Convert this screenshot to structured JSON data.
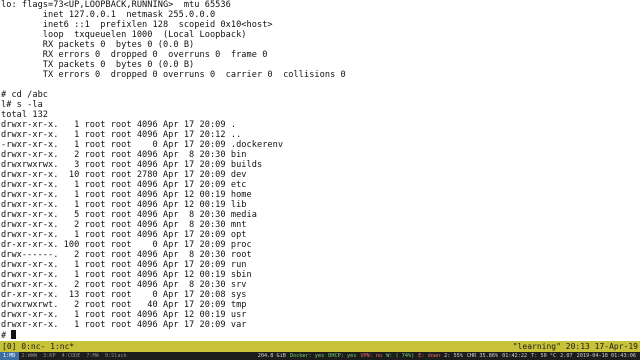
{
  "terminal": {
    "lines": [
      "lo: flags=73<UP,LOOPBACK,RUNNING>  mtu 65536",
      "        inet 127.0.0.1  netmask 255.0.0.0",
      "        inet6 ::1  prefixlen 128  scopeid 0x10<host>",
      "        loop  txqueuelen 1000  (Local Loopback)",
      "        RX packets 0  bytes 0 (0.0 B)",
      "        RX errors 0  dropped 0  overruns 0  frame 0",
      "        TX packets 0  bytes 0 (0.0 B)",
      "        TX errors 0  dropped 0 overruns 0  carrier 0  collisions 0",
      "",
      "# cd /abc",
      "l# s -la",
      "total 132",
      "drwxr-xr-x.   1 root root 4096 Apr 17 20:09 .",
      "drwxr-xr-x.   1 root root 4096 Apr 17 20:12 ..",
      "-rwxr-xr-x.   1 root root    0 Apr 17 20:09 .dockerenv",
      "drwxr-xr-x.   2 root root 4096 Apr  8 20:30 bin",
      "drwxrwxrwx.   3 root root 4096 Apr 17 20:09 builds",
      "drwxr-xr-x.  10 root root 2780 Apr 17 20:09 dev",
      "drwxr-xr-x.   1 root root 4096 Apr 17 20:09 etc",
      "drwxr-xr-x.   1 root root 4096 Apr 12 00:19 home",
      "drwxr-xr-x.   1 root root 4096 Apr 12 00:19 lib",
      "drwxr-xr-x.   5 root root 4096 Apr  8 20:30 media",
      "drwxr-xr-x.   2 root root 4096 Apr  8 20:30 mnt",
      "drwxr-xr-x.   1 root root 4096 Apr 17 20:09 opt",
      "dr-xr-xr-x. 100 root root    0 Apr 17 20:09 proc",
      "drwx------.   2 root root 4096 Apr  8 20:30 root",
      "drwxr-xr-x.   1 root root 4096 Apr 17 20:09 run",
      "drwxr-xr-x.   1 root root 4096 Apr 12 00:19 sbin",
      "drwxr-xr-x.   2 root root 4096 Apr  8 20:30 srv",
      "dr-xr-xr-x.  13 root root    0 Apr 17 20:08 sys",
      "drwxrwxrwt.   2 root root   40 Apr 17 20:09 tmp",
      "drwxr-xr-x.   1 root root 4096 Apr 12 00:19 usr",
      "drwxr-xr-x.   1 root root 4096 Apr 17 20:09 var",
      "# "
    ]
  },
  "tmux": {
    "left": "[0] 0:nc- 1:nc*",
    "right": "\"learning\" 20:13 17-Apr-19",
    "bar_color": "#c8c238"
  },
  "wm": {
    "workspaces": [
      "1:MD",
      "2:WWW",
      "3:KP",
      "4:CODE",
      "7:MA",
      "9:Slack"
    ],
    "active_index": 0,
    "status": [
      {
        "text": "204.8 GiB",
        "tone": "normal"
      },
      {
        "text": "Docker: yes",
        "tone": "green"
      },
      {
        "text": "DHCP: yes",
        "tone": "green"
      },
      {
        "text": "VPN: no",
        "tone": "red"
      },
      {
        "text": "W: ( 74%)",
        "tone": "green"
      },
      {
        "text": "E: down",
        "tone": "red"
      },
      {
        "text": "2: 55%",
        "tone": "normal"
      },
      {
        "text": "CHR 35.86%",
        "tone": "normal"
      },
      {
        "text": "01:42:22",
        "tone": "normal"
      },
      {
        "text": "T: 50 °C",
        "tone": "normal"
      },
      {
        "text": "2.07",
        "tone": "normal"
      },
      {
        "text": "2019-04-18 01:43:06",
        "tone": "normal"
      }
    ]
  }
}
